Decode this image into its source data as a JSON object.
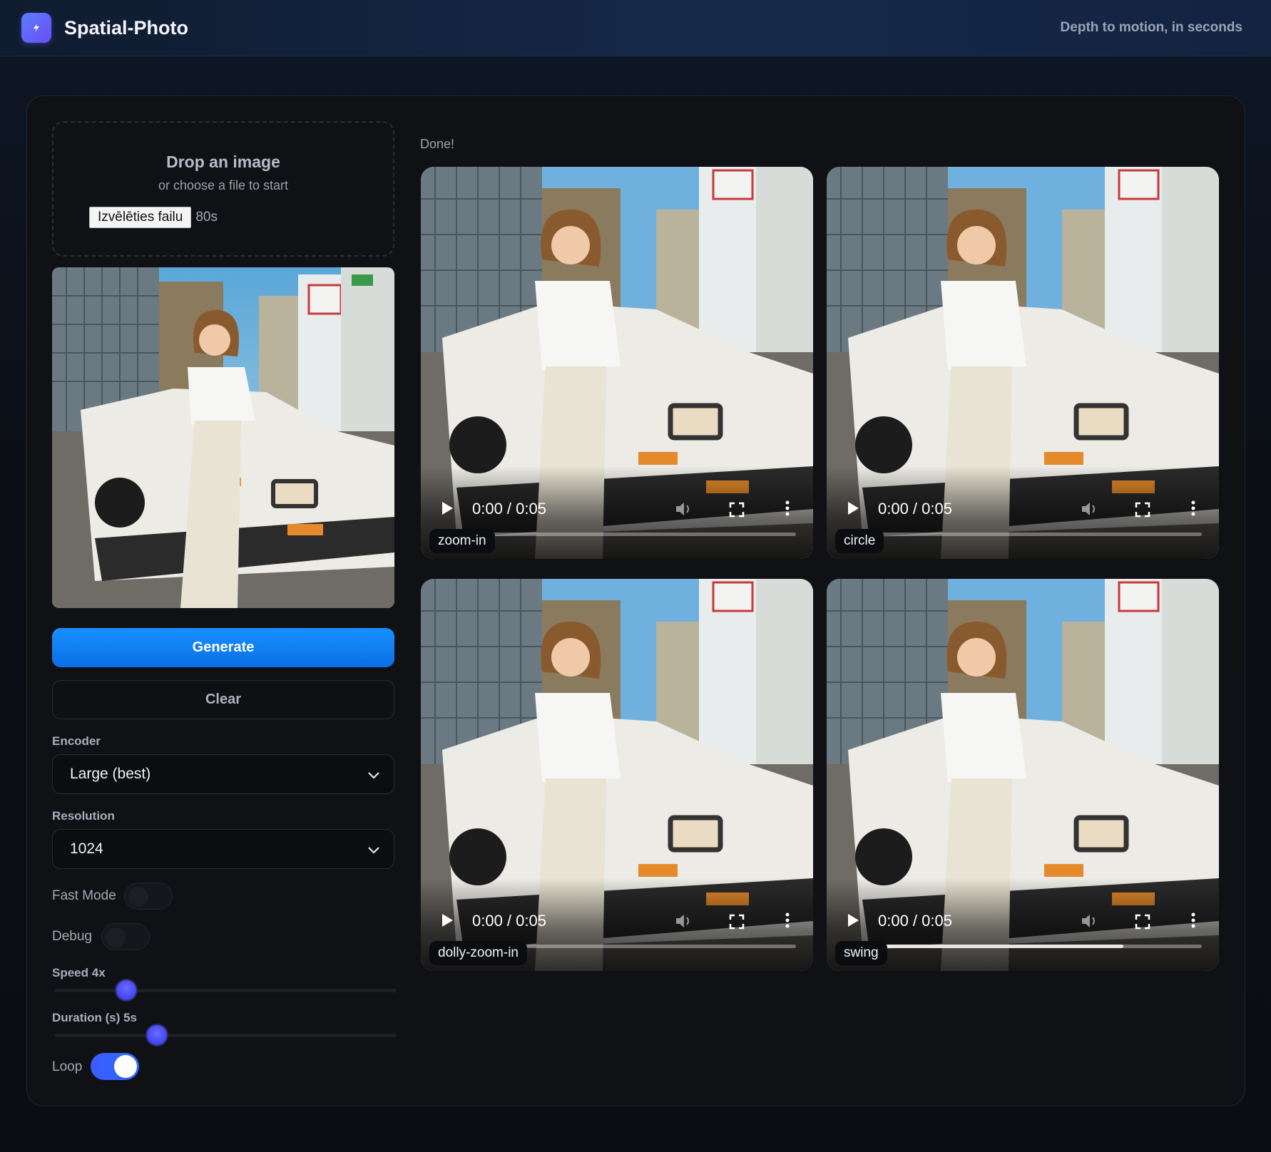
{
  "header": {
    "app_title": "Spatial-Photo",
    "tagline": "Depth to motion, in seconds",
    "logo_icon": "bolt-icon"
  },
  "upload": {
    "title": "Drop an image",
    "subtitle": "or choose a file to start",
    "file_button_label": "Izvēlēties failu",
    "file_name": "80s"
  },
  "actions": {
    "generate_label": "Generate",
    "clear_label": "Clear"
  },
  "settings": {
    "encoder": {
      "label": "Encoder",
      "value": "Large (best)"
    },
    "resolution": {
      "label": "Resolution",
      "value": "1024"
    },
    "fast_mode": {
      "label": "Fast Mode",
      "on": false
    },
    "debug": {
      "label": "Debug",
      "on": false
    },
    "speed": {
      "label": "Speed 4x",
      "value": 4,
      "fraction": 0.21
    },
    "duration": {
      "label": "Duration (s) 5s",
      "value": 5,
      "fraction": 0.3
    },
    "loop": {
      "label": "Loop",
      "on": true
    }
  },
  "status": "Done!",
  "videos": [
    {
      "label": "zoom-in",
      "time": "0:00 / 0:05",
      "progress": 0.0
    },
    {
      "label": "circle",
      "time": "0:00 / 0:05",
      "progress": 0.0
    },
    {
      "label": "dolly-zoom-in",
      "time": "0:00 / 0:05",
      "progress": 0.0
    },
    {
      "label": "swing",
      "time": "0:00 / 0:05",
      "progress": 0.78
    }
  ],
  "colors": {
    "accent": "#0a7cff",
    "slider_thumb": "#4a4ff5",
    "toggle_on": "#3d5bff"
  }
}
